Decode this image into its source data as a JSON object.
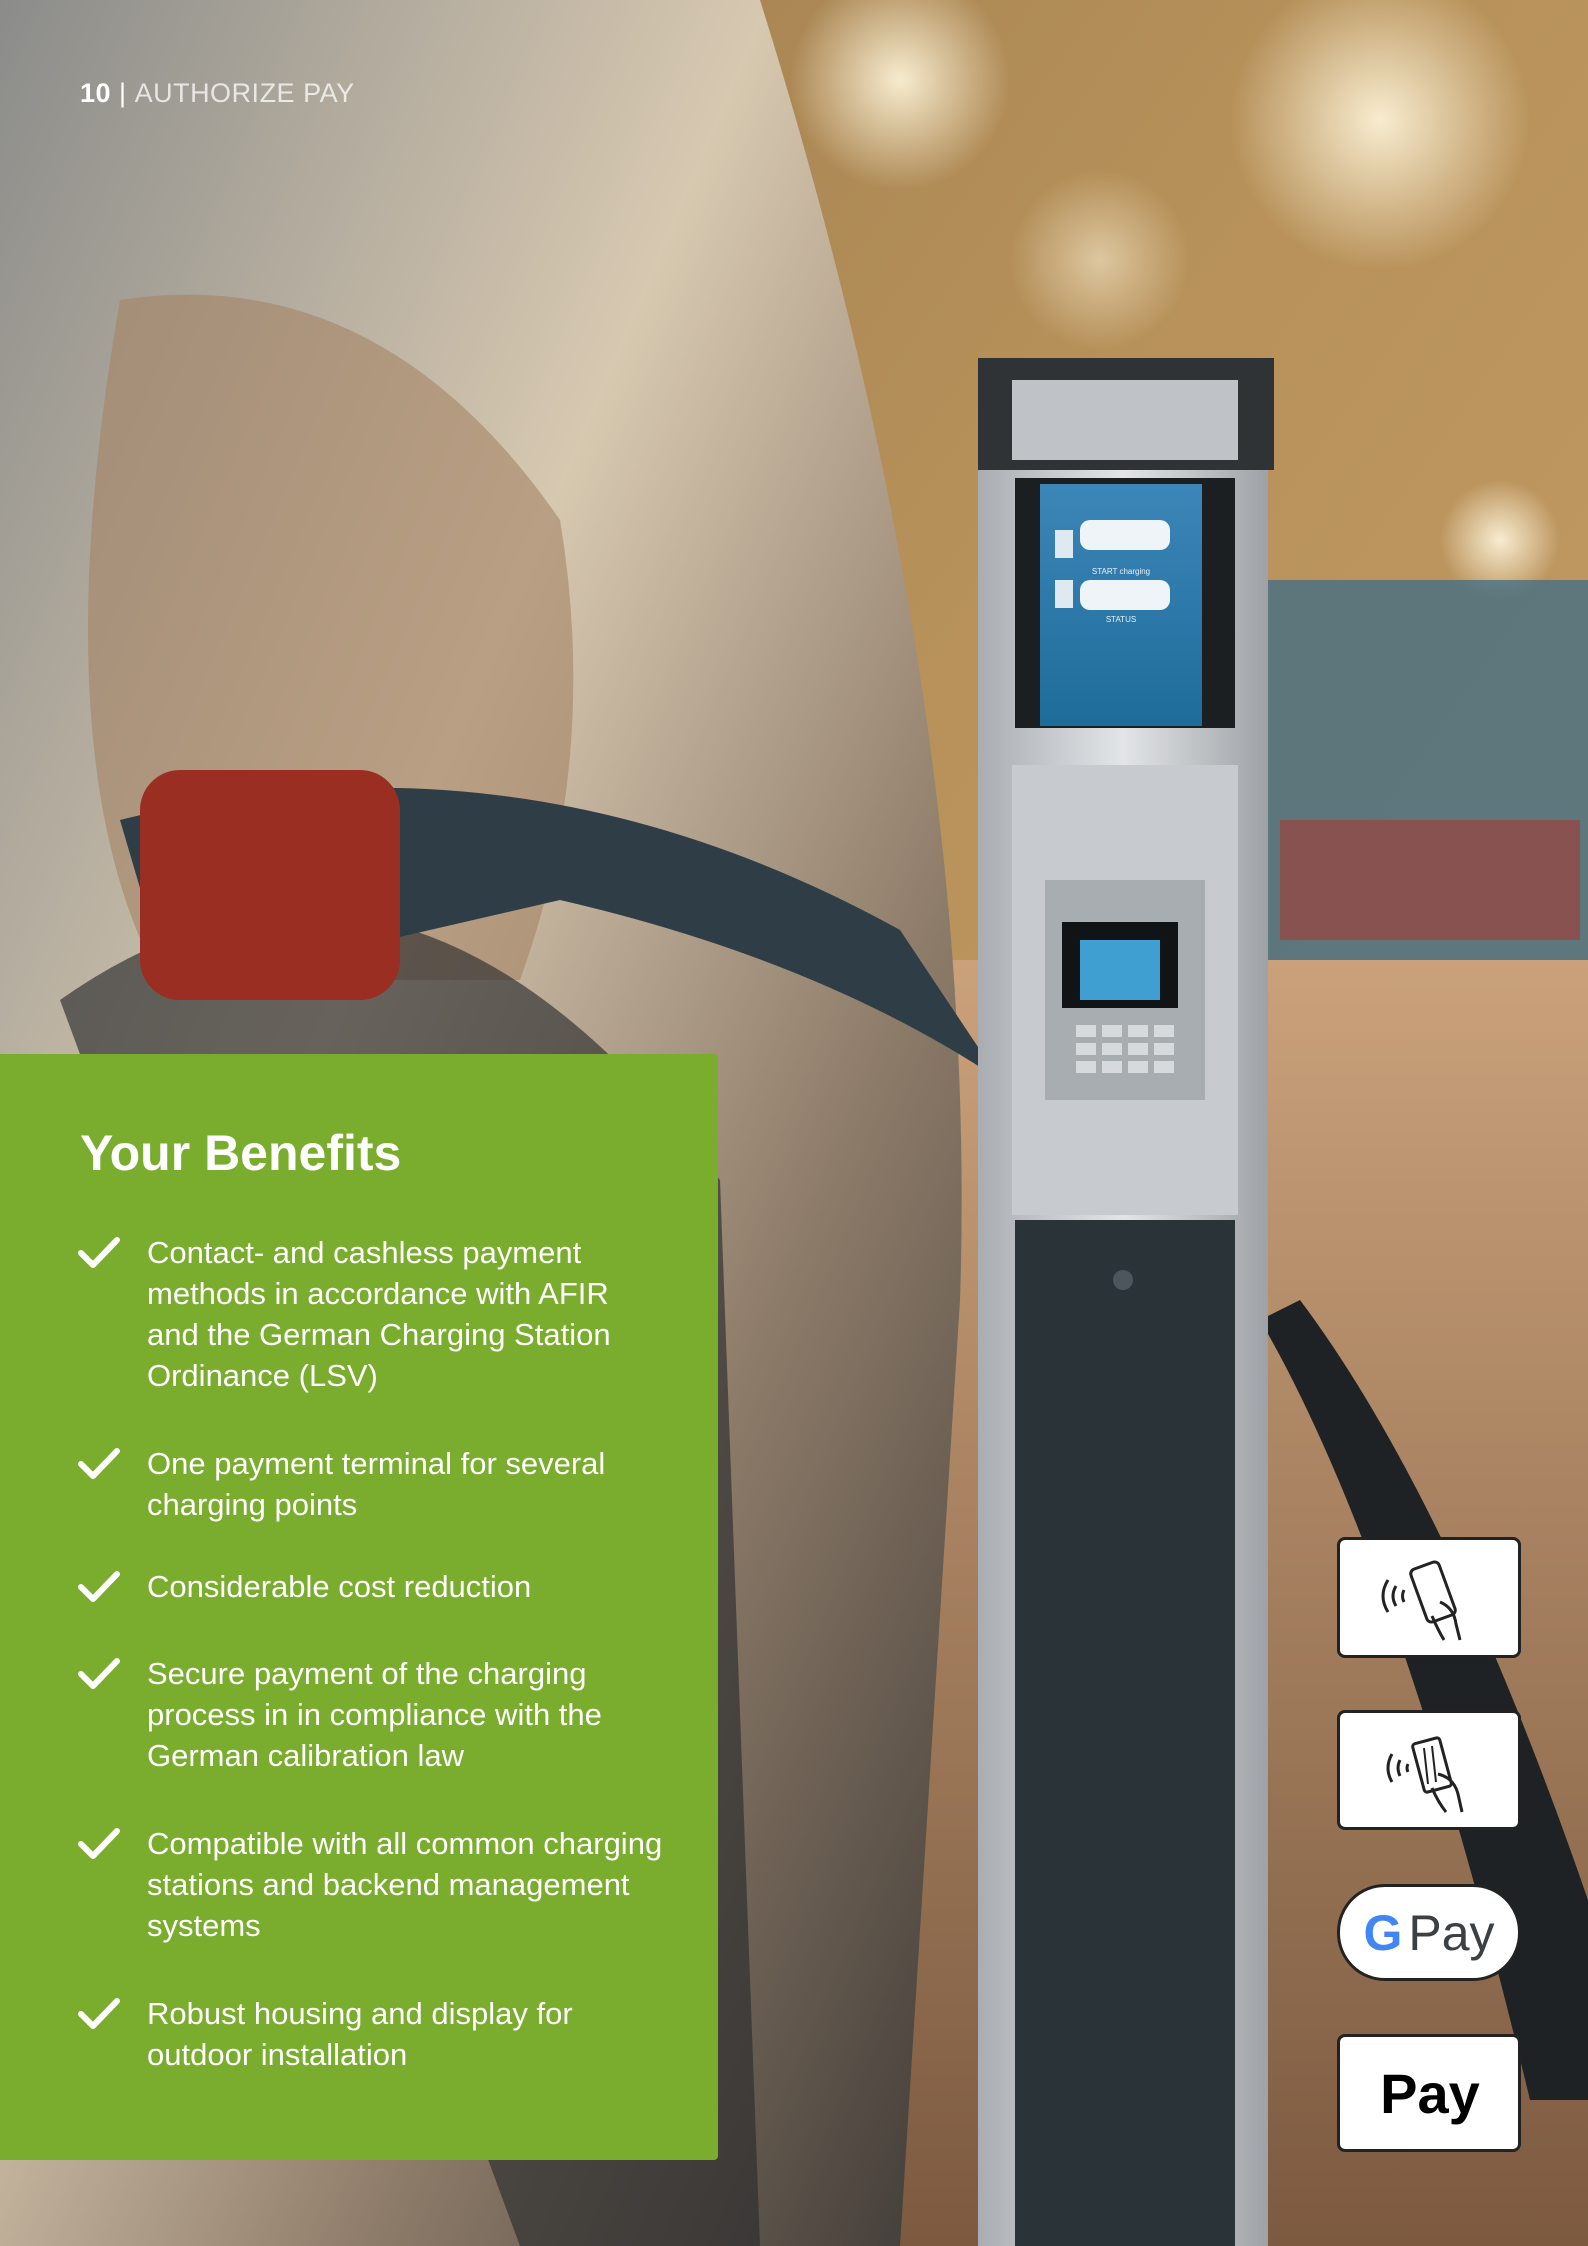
{
  "header": {
    "page_number": "10",
    "separator": "|",
    "section": "AUTHORIZE PAY"
  },
  "benefits": {
    "title": "Your Benefits",
    "items": [
      "Contact- and cashless payment methods in accordance with AFIR and the German Charging Station Ordinance (LSV)",
      "One payment terminal for several charging points",
      "Considerable cost reduction",
      "Secure payment of the charging process in in compliance with the German calibration law",
      "Compatible with all common charging stations and backend management systems",
      "Robust housing and display for outdoor installation"
    ]
  },
  "payment_methods": {
    "nfc_phone": "contactless-phone-icon",
    "nfc_card": "contactless-card-icon",
    "google_pay": {
      "g": "G",
      "label": "Pay"
    },
    "apple_pay": {
      "logo": "",
      "label": "Pay"
    }
  },
  "charger_screen": {
    "line1": "START charging",
    "line2": "STATUS"
  },
  "colors": {
    "panel": "#7aac2e",
    "text": "#ffffff"
  }
}
